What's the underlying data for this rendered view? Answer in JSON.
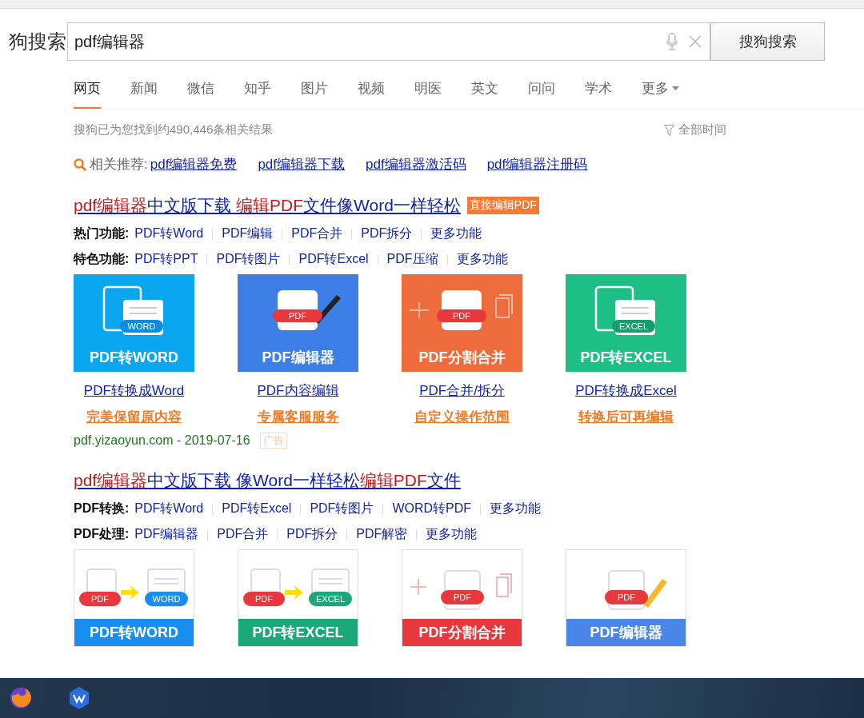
{
  "logo": "狗搜索",
  "search": {
    "value": "pdf编辑器",
    "button": "搜狗搜索"
  },
  "tabs": [
    {
      "label": "网页",
      "selected": true,
      "kind": "tab"
    },
    {
      "label": "新闻",
      "selected": false,
      "kind": "tab"
    },
    {
      "label": "微信",
      "selected": false,
      "kind": "tab"
    },
    {
      "label": "知乎",
      "selected": false,
      "kind": "tab"
    },
    {
      "label": "图片",
      "selected": false,
      "kind": "tab"
    },
    {
      "label": "视频",
      "selected": false,
      "kind": "tab"
    },
    {
      "label": "明医",
      "selected": false,
      "kind": "tab"
    },
    {
      "label": "英文",
      "selected": false,
      "kind": "tab"
    },
    {
      "label": "问问",
      "selected": false,
      "kind": "tab"
    },
    {
      "label": "学术",
      "selected": false,
      "kind": "tab"
    },
    {
      "label": "更多",
      "selected": false,
      "kind": "menu"
    }
  ],
  "result_count": "搜狗已为您找到约490,446条相关结果",
  "time_filter": "全部时间",
  "related": {
    "label": "相关推荐:",
    "links": [
      "pdf编辑器免费",
      "pdf编辑器下载",
      "pdf编辑器激活码",
      "pdf编辑器注册码"
    ]
  },
  "results": [
    {
      "title": [
        {
          "text": "pdf编辑器",
          "highlight": true
        },
        {
          "text": "中文版下载 ",
          "highlight": false
        },
        {
          "text": "编辑PDF",
          "highlight": true
        },
        {
          "text": "文件像Word一样轻松",
          "highlight": false
        }
      ],
      "badge": "直接编辑PDF",
      "feature_rows": [
        {
          "label": "热门功能:",
          "links": [
            "PDF转Word",
            "PDF编辑",
            "PDF合并",
            "PDF拆分",
            "更多功能"
          ]
        },
        {
          "label": "特色功能:",
          "links": [
            "PDF转PPT",
            "PDF转图片",
            "PDF转Excel",
            "PDF压缩",
            "更多功能"
          ]
        }
      ],
      "tiles": [
        {
          "color": "#0aa6f0",
          "kind": "convert",
          "caption": "PDF转WORD",
          "tags": [
            {
              "text": "WORD",
              "color": "#0a8de0"
            }
          ],
          "link": "PDF转换成Word",
          "tagline": "完美保留原内容"
        },
        {
          "color": "#3d7fe6",
          "kind": "edit",
          "caption": "PDF编辑器",
          "tags": [
            {
              "text": "PDF",
              "color": "#e8383d"
            }
          ],
          "link": "PDF内容编辑",
          "tagline": "专属客服服务"
        },
        {
          "color": "#ee6b3b",
          "kind": "split",
          "caption": "PDF分割合并",
          "tags": [
            {
              "text": "PDF",
              "color": "#e8383d"
            }
          ],
          "link": "PDF合并/拆分",
          "tagline": "自定义操作范围"
        },
        {
          "color": "#1dbf86",
          "kind": "convert",
          "caption": "PDF转EXCEL",
          "tags": [
            {
              "text": "EXCEL",
              "color": "#14a06c"
            }
          ],
          "link": "PDF转换成Excel",
          "tagline": "转换后可再编辑"
        }
      ],
      "source": "pdf.yizaoyun.com - 2019-07-16",
      "ad_label": "广告"
    },
    {
      "title": [
        {
          "text": "pdf编辑器",
          "highlight": true
        },
        {
          "text": "中文版下载 像Word一样轻松",
          "highlight": false
        },
        {
          "text": "编辑PDF",
          "highlight": true
        },
        {
          "text": "文件",
          "highlight": false
        }
      ],
      "feature_rows": [
        {
          "label": "PDF转换:",
          "links": [
            "PDF转Word",
            "PDF转Excel",
            "PDF转图片",
            "WORD转PDF",
            "更多功能"
          ]
        },
        {
          "label": "PDF处理:",
          "links": [
            "PDF编辑器",
            "PDF合并",
            "PDF拆分",
            "PDF解密",
            "更多功能"
          ]
        }
      ],
      "tiles": [
        {
          "color": "#1a8ef0",
          "kind": "card-convert",
          "caption": "PDF转WORD",
          "tags": [
            {
              "text": "PDF",
              "color": "#e8383d"
            },
            {
              "text": "WORD",
              "color": "#1a8ef0"
            }
          ]
        },
        {
          "color": "#1aa878",
          "kind": "card-convert",
          "caption": "PDF转EXCEL",
          "tags": [
            {
              "text": "PDF",
              "color": "#e8383d"
            },
            {
              "text": "EXCEL",
              "color": "#1aa878"
            }
          ]
        },
        {
          "color": "#e8383d",
          "kind": "card-split",
          "caption": "PDF分割合并",
          "tags": [
            {
              "text": "PDF",
              "color": "#e8383d"
            }
          ]
        },
        {
          "color": "#4a86e8",
          "kind": "card-edit",
          "caption": "PDF编辑器",
          "tags": [
            {
              "text": "PDF",
              "color": "#e8383d"
            }
          ]
        }
      ]
    }
  ]
}
